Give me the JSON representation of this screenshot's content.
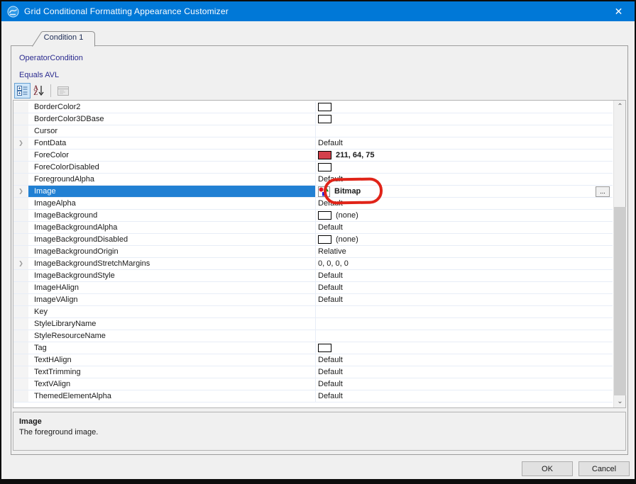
{
  "window": {
    "title": "Grid Conditional Formatting Appearance Customizer"
  },
  "icons": {
    "close": "✕",
    "expander": "❯",
    "ellipsis": "...",
    "scroll_up": "⌃",
    "scroll_down": "⌄",
    "sort_a": "A",
    "sort_z": "Z"
  },
  "colors": {
    "titlebar": "#0078d7",
    "dialog_bg": "#f0f0f0",
    "selection": "#2180d3",
    "annotation": "#e02419",
    "forecolor_swatch": "#d3404b"
  },
  "tab": {
    "label": "Condition 1"
  },
  "condition": {
    "operator_label": "OperatorCondition",
    "expression": "Equals AVL"
  },
  "grid": {
    "rows": [
      {
        "name": "BorderColor2",
        "swatch": "#ffffff"
      },
      {
        "name": "BorderColor3DBase",
        "swatch": "#ffffff"
      },
      {
        "name": "Cursor"
      },
      {
        "name": "FontData",
        "expandable": true,
        "value": "Default"
      },
      {
        "name": "ForeColor",
        "swatch": "#d3404b",
        "value": "211, 64, 75",
        "bold": true
      },
      {
        "name": "ForeColorDisabled",
        "swatch": "#ffffff"
      },
      {
        "name": "ForegroundAlpha",
        "value": "Default"
      },
      {
        "name": "Image",
        "expandable": true,
        "selected": true,
        "thumbnail": true,
        "value": "Bitmap",
        "bold": true,
        "editor_button": true,
        "annotated": true
      },
      {
        "name": "ImageAlpha",
        "value": "Default"
      },
      {
        "name": "ImageBackground",
        "swatch": "#ffffff",
        "value": "(none)"
      },
      {
        "name": "ImageBackgroundAlpha",
        "value": "Default"
      },
      {
        "name": "ImageBackgroundDisabled",
        "swatch": "#ffffff",
        "value": "(none)"
      },
      {
        "name": "ImageBackgroundOrigin",
        "value": "Relative"
      },
      {
        "name": "ImageBackgroundStretchMargins",
        "expandable": true,
        "value": "0, 0, 0, 0"
      },
      {
        "name": "ImageBackgroundStyle",
        "value": "Default"
      },
      {
        "name": "ImageHAlign",
        "value": "Default"
      },
      {
        "name": "ImageVAlign",
        "value": "Default"
      },
      {
        "name": "Key"
      },
      {
        "name": "StyleLibraryName"
      },
      {
        "name": "StyleResourceName"
      },
      {
        "name": "Tag",
        "swatch": "#ffffff"
      },
      {
        "name": "TextHAlign",
        "value": "Default"
      },
      {
        "name": "TextTrimming",
        "value": "Default"
      },
      {
        "name": "TextVAlign",
        "value": "Default"
      },
      {
        "name": "ThemedElementAlpha",
        "value": "Default"
      }
    ]
  },
  "description": {
    "title": "Image",
    "text": "The foreground image."
  },
  "buttons": {
    "ok": "OK",
    "cancel": "Cancel"
  }
}
